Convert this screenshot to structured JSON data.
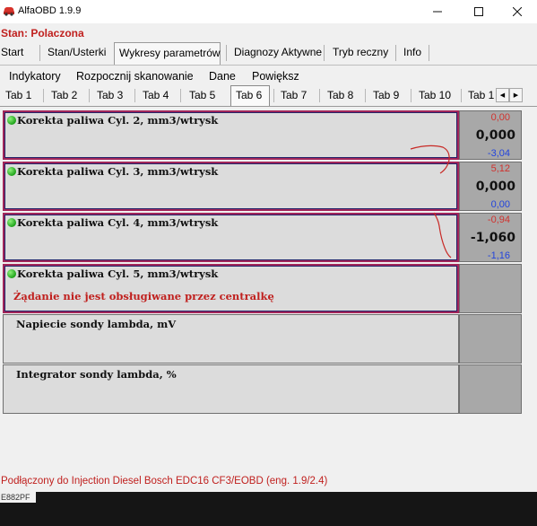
{
  "window": {
    "title": "AlfaOBD 1.9.9",
    "minimize_icon": "minimize-icon",
    "maximize_icon": "maximize-icon",
    "close_icon": "close-icon"
  },
  "status": "Stan: Polaczona",
  "main_tabs": [
    {
      "label": "Start"
    },
    {
      "label": "Stan/Usterki"
    },
    {
      "label": "Wykresy parametrów",
      "active": true
    },
    {
      "label": "Diagnozy Aktywne"
    },
    {
      "label": "Tryb reczny"
    },
    {
      "label": "Info"
    }
  ],
  "submenu": {
    "indicators": "Indykatory",
    "start_scan": "Rozpocznij skanowanie",
    "data": "Dane",
    "zoom": "Powiększ"
  },
  "tabs": [
    {
      "label": "Tab 1"
    },
    {
      "label": "Tab 2"
    },
    {
      "label": "Tab 3"
    },
    {
      "label": "Tab 4"
    },
    {
      "label": "Tab 5"
    },
    {
      "label": "Tab 6",
      "active": true
    },
    {
      "label": "Tab 7"
    },
    {
      "label": "Tab 8"
    },
    {
      "label": "Tab 9"
    },
    {
      "label": "Tab 10"
    },
    {
      "label": "Tab 1"
    }
  ],
  "tab_scroll": {
    "left": "◀",
    "right": "▶"
  },
  "panels": [
    {
      "name": "Korekta paliwa Cyl. 2, mm3/wtrysk",
      "max": "0,00",
      "value": "0,000",
      "min": "-3,04"
    },
    {
      "name": "Korekta paliwa Cyl. 3, mm3/wtrysk",
      "max": "5,12",
      "value": "0,000",
      "min": "0,00"
    },
    {
      "name": "Korekta paliwa Cyl. 4, mm3/wtrysk",
      "max": "-0,94",
      "value": "-1,060",
      "min": "-1,16"
    },
    {
      "name": "Korekta paliwa Cyl. 5, mm3/wtrysk",
      "error": "Żądanie nie jest obsługiwane przez centralkę"
    },
    {
      "name": "Napiecie sondy lambda, mV"
    },
    {
      "name": "Integrator sondy lambda, %"
    }
  ],
  "connection": "Podłączony do Injection Diesel Bosch EDC16 CF3/EOBD (eng. 1.9/2.4)",
  "background_text": "E882PF",
  "colors": {
    "status_red": "#c0201e",
    "panel_highlight": "#a2265a",
    "max_value": "#d0322e",
    "min_value": "#2244dd",
    "indicator_green": "#1ea21a"
  }
}
